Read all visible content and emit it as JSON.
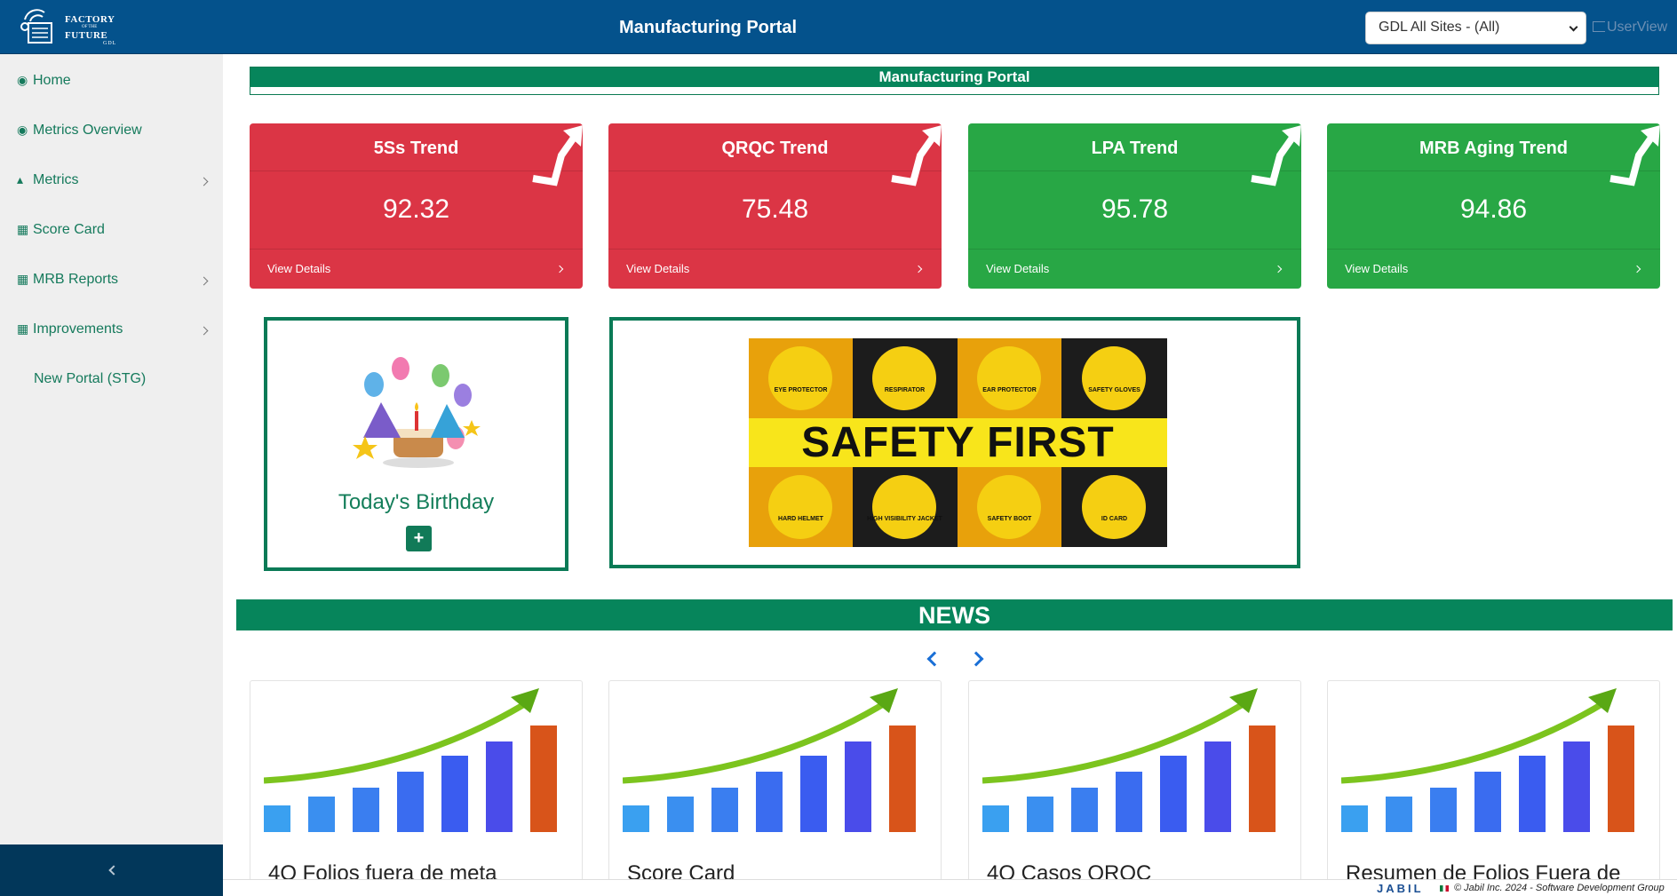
{
  "header": {
    "logo_text": [
      "FACTORY",
      "OF THE",
      "FUTURE",
      "GDL"
    ],
    "title": "Manufacturing Portal",
    "site_select": "GDL All Sites - (All)",
    "userview": "UserView"
  },
  "sidebar": {
    "items": [
      {
        "label": "Home",
        "icon": "dashboard-icon"
      },
      {
        "label": "Metrics Overview",
        "icon": "dashboard-icon"
      },
      {
        "label": "Metrics",
        "icon": "area-chart-icon"
      },
      {
        "label": "Score Card",
        "icon": "table-icon"
      },
      {
        "label": "MRB Reports",
        "icon": "table-icon"
      },
      {
        "label": "Improvements",
        "icon": "table-icon"
      },
      {
        "label": "New Portal (STG)",
        "icon": ""
      }
    ]
  },
  "banner": {
    "title": "Manufacturing Portal"
  },
  "cards": [
    {
      "title": "5Ss Trend",
      "value": "92.32",
      "link": "View Details",
      "status": "red"
    },
    {
      "title": "QRQC Trend",
      "value": "75.48",
      "link": "View Details",
      "status": "red"
    },
    {
      "title": "LPA Trend",
      "value": "95.78",
      "link": "View Details",
      "status": "green"
    },
    {
      "title": "MRB Aging Trend",
      "value": "94.86",
      "link": "View Details",
      "status": "green"
    }
  ],
  "birthday": {
    "title": "Today's Birthday",
    "add": "+"
  },
  "safety": {
    "headline": "SAFETY FIRST",
    "items": [
      "EYE PROTECTOR",
      "RESPIRATOR",
      "EAR PROTECTOR",
      "SAFETY GLOVES",
      "HARD HELMET",
      "HIGH VISIBILITY JACKET",
      "SAFETY BOOT",
      "ID CARD"
    ]
  },
  "news": {
    "title": "NEWS",
    "items": [
      "4Q Folios fuera de meta",
      "Score Card",
      "4Q Casos QRQC",
      "Resumen de Folios Fuera de"
    ]
  },
  "footer": {
    "brand": "JABIL",
    "copyright": "© Jabil Inc. 2024 - Software Development Group"
  },
  "colors": {
    "header_bg": "#04528c",
    "sidebar_bg": "#efefef",
    "green": "#28a745",
    "red": "#db3545",
    "portal_green": "#06855b"
  }
}
